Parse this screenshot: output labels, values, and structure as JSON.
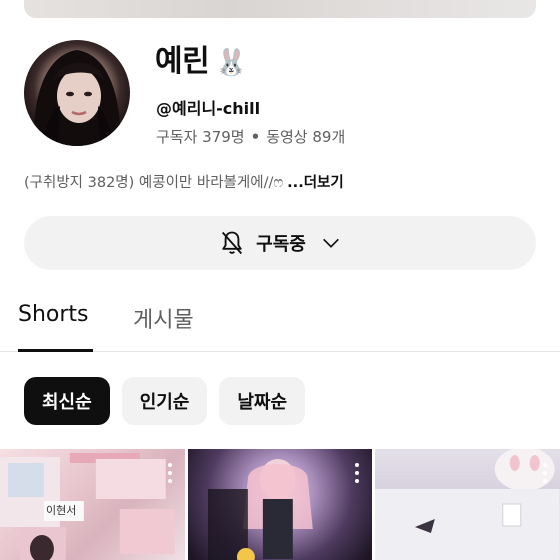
{
  "channel": {
    "name": "예린",
    "name_emoji": "🐰",
    "handle": "@예리니-chill",
    "subscribers": "구독자 379명",
    "separator": "•",
    "videos": "동영상 89개",
    "description": "(구취방지 382명) 예콩이만 바라볼게에//ෆ",
    "more_label": "...더보기"
  },
  "subscribe_button": {
    "label": "구독중",
    "bell_icon": "bell-off-icon",
    "chevron_icon": "chevron-down-icon"
  },
  "tabs": [
    {
      "label": "Shorts",
      "active": true
    },
    {
      "label": "게시물",
      "active": false
    }
  ],
  "sort_chips": [
    {
      "label": "최신순",
      "selected": true
    },
    {
      "label": "인기순",
      "selected": false
    },
    {
      "label": "날짜순",
      "selected": false
    }
  ],
  "shorts": [
    {
      "label": "이현서"
    },
    {
      "label": ""
    },
    {
      "label": ""
    }
  ]
}
